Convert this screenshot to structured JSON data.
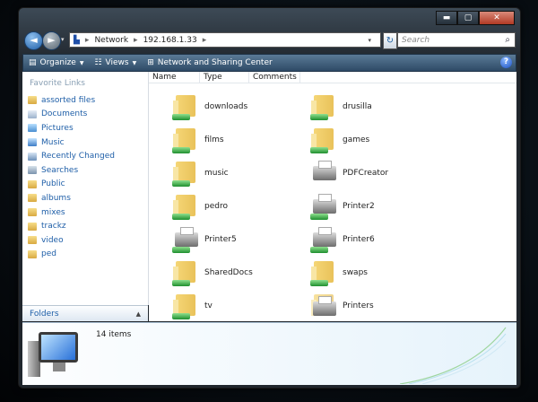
{
  "window": {
    "caption_buttons": {
      "minimize": "▬",
      "maximize": "▢",
      "close": "✕"
    }
  },
  "address": {
    "segments": [
      "Network",
      "192.168.1.33"
    ],
    "separator": "▸"
  },
  "search": {
    "placeholder": "Search"
  },
  "toolbar": {
    "organize": "Organize",
    "views": "Views",
    "network_center": "Network and Sharing Center",
    "help": "?"
  },
  "nav_pane": {
    "title": "Favorite Links",
    "items": [
      {
        "label": "assorted files",
        "icon": "folder-icon"
      },
      {
        "label": "Documents",
        "icon": "documents-icon"
      },
      {
        "label": "Pictures",
        "icon": "pictures-icon"
      },
      {
        "label": "Music",
        "icon": "music-icon"
      },
      {
        "label": "Recently Changed",
        "icon": "recently-changed-icon"
      },
      {
        "label": "Searches",
        "icon": "searches-icon"
      },
      {
        "label": "Public",
        "icon": "folder-icon"
      },
      {
        "label": "albums",
        "icon": "folder-icon"
      },
      {
        "label": "mixes",
        "icon": "folder-icon"
      },
      {
        "label": "trackz",
        "icon": "folder-icon"
      },
      {
        "label": "video",
        "icon": "folder-icon"
      },
      {
        "label": "ped",
        "icon": "folder-icon"
      }
    ],
    "folders_label": "Folders"
  },
  "columns": [
    "Name",
    "Type",
    "Comments"
  ],
  "items": [
    {
      "label": "downloads",
      "kind": "shared-folder"
    },
    {
      "label": "drusilla",
      "kind": "shared-folder"
    },
    {
      "label": "films",
      "kind": "shared-folder"
    },
    {
      "label": "games",
      "kind": "shared-folder"
    },
    {
      "label": "music",
      "kind": "shared-folder"
    },
    {
      "label": "PDFCreator",
      "kind": "printer"
    },
    {
      "label": "pedro",
      "kind": "shared-folder"
    },
    {
      "label": "Printer2",
      "kind": "shared-printer"
    },
    {
      "label": "Printer5",
      "kind": "shared-printer"
    },
    {
      "label": "Printer6",
      "kind": "shared-printer"
    },
    {
      "label": "SharedDocs",
      "kind": "shared-folder"
    },
    {
      "label": "swaps",
      "kind": "shared-folder"
    },
    {
      "label": "tv",
      "kind": "shared-folder"
    },
    {
      "label": "Printers",
      "kind": "printers-folder"
    }
  ],
  "details": {
    "count": "14 items"
  }
}
